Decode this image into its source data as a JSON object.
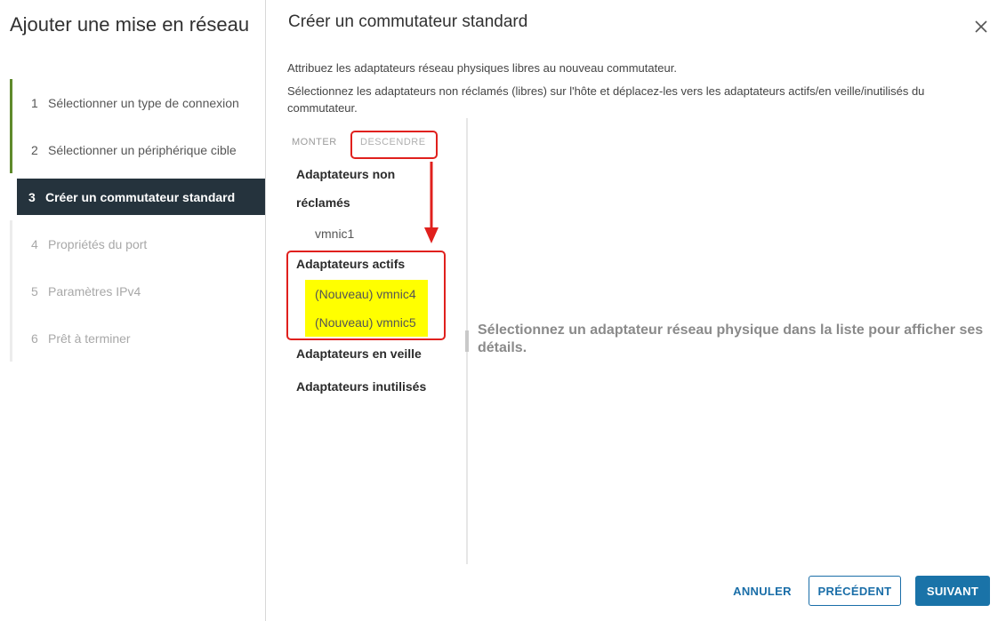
{
  "sidebar": {
    "title": "Ajouter une mise en réseau",
    "steps": [
      {
        "num": "1",
        "label": "Sélectionner un type de connexion"
      },
      {
        "num": "2",
        "label": "Sélectionner un périphérique cible"
      },
      {
        "num": "3",
        "label": "Créer un commutateur standard"
      },
      {
        "num": "4",
        "label": "Propriétés du port"
      },
      {
        "num": "5",
        "label": "Paramètres IPv4"
      },
      {
        "num": "6",
        "label": "Prêt à terminer"
      }
    ]
  },
  "main": {
    "title": "Créer un commutateur standard",
    "description1": "Attribuez les adaptateurs réseau physiques libres au nouveau commutateur.",
    "description2": "Sélectionnez les adaptateurs non réclamés (libres) sur l'hôte et déplacez-les vers les adaptateurs actifs/en veille/inutilisés du commutateur.",
    "toolbar": {
      "move_up": "MONTER",
      "move_down": "DESCENDRE"
    },
    "groups": {
      "unclaimed_line1": "Adaptateurs non",
      "unclaimed_line2": "réclamés",
      "unclaimed_items": [
        "vmnic1"
      ],
      "active": "Adaptateurs actifs",
      "active_items": [
        "(Nouveau) vmnic4",
        "(Nouveau) vmnic5"
      ],
      "standby": "Adaptateurs en veille",
      "unused": "Adaptateurs inutilisés"
    },
    "detail_placeholder": "Sélectionnez un adaptateur réseau physique dans la liste pour afficher ses détails."
  },
  "footer": {
    "cancel": "ANNULER",
    "previous": "PRÉCÉDENT",
    "next": "SUIVANT"
  },
  "colors": {
    "active_step_bg": "#25333d",
    "completed_step_bar": "#5f8a2c",
    "new_item_highlight": "#ffff00",
    "annotation_red": "#e0201d",
    "primary_blue": "#1a73a8"
  },
  "icons": {
    "close": "close-icon"
  }
}
